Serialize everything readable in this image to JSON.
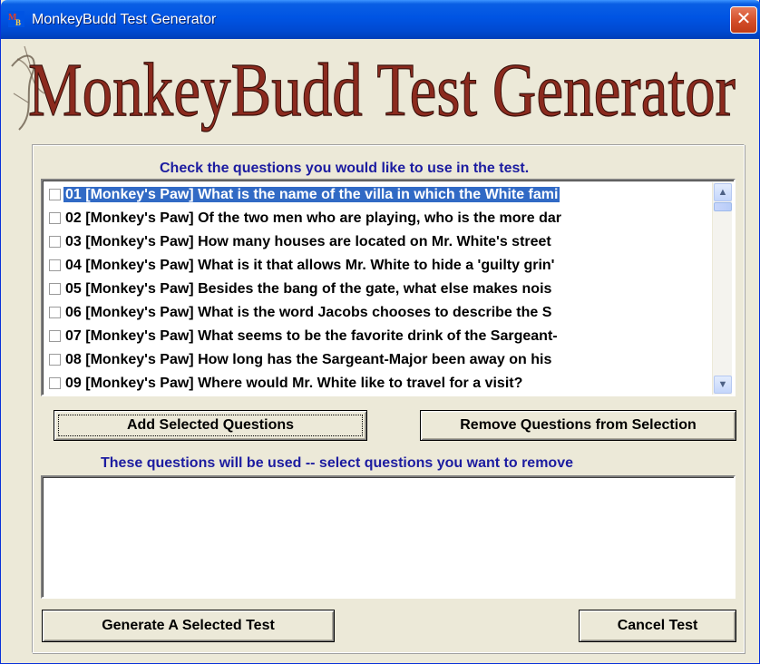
{
  "window": {
    "title": "MonkeyBudd Test Generator",
    "close_label": "✕"
  },
  "banner": {
    "text": "MonkeyBudd Test Generator",
    "color": "#8b2a1e"
  },
  "questions_panel": {
    "instruction": "Check the questions you would like to use in the test.",
    "items": [
      {
        "label": "01 [Monkey's Paw]  What is the name of the villa in which the White fami",
        "checked": false,
        "selected": true
      },
      {
        "label": "02 [Monkey's Paw]  Of the two men who are playing, who is the more dar",
        "checked": false,
        "selected": false
      },
      {
        "label": "03 [Monkey's Paw]  How many houses are located on Mr. White's street",
        "checked": false,
        "selected": false
      },
      {
        "label": "04 [Monkey's Paw]  What is it that allows Mr. White to hide a 'guilty grin'",
        "checked": false,
        "selected": false
      },
      {
        "label": "05 [Monkey's Paw]  Besides the bang of the gate, what else makes nois",
        "checked": false,
        "selected": false
      },
      {
        "label": "06 [Monkey's Paw]  What is the word Jacobs chooses to describe the S",
        "checked": false,
        "selected": false
      },
      {
        "label": "07 [Monkey's Paw]  What seems to be the favorite drink of the Sargeant-",
        "checked": false,
        "selected": false
      },
      {
        "label": "08 [Monkey's Paw]  How long has the Sargeant-Major been away on his",
        "checked": false,
        "selected": false
      },
      {
        "label": "09 [Monkey's Paw]  Where would Mr. White like to travel for a visit?",
        "checked": false,
        "selected": false
      }
    ]
  },
  "buttons": {
    "add_label": "Add Selected Questions",
    "remove_label": "Remove Questions from Selection",
    "generate_label": "Generate A Selected Test",
    "cancel_label": "Cancel Test"
  },
  "selected_panel": {
    "instruction": "These questions will be used --  select questions you want to remove",
    "items": []
  },
  "colors": {
    "selection": "#316ac5",
    "label_blue": "#1c1ca0",
    "titlebar": "#0054e3"
  }
}
